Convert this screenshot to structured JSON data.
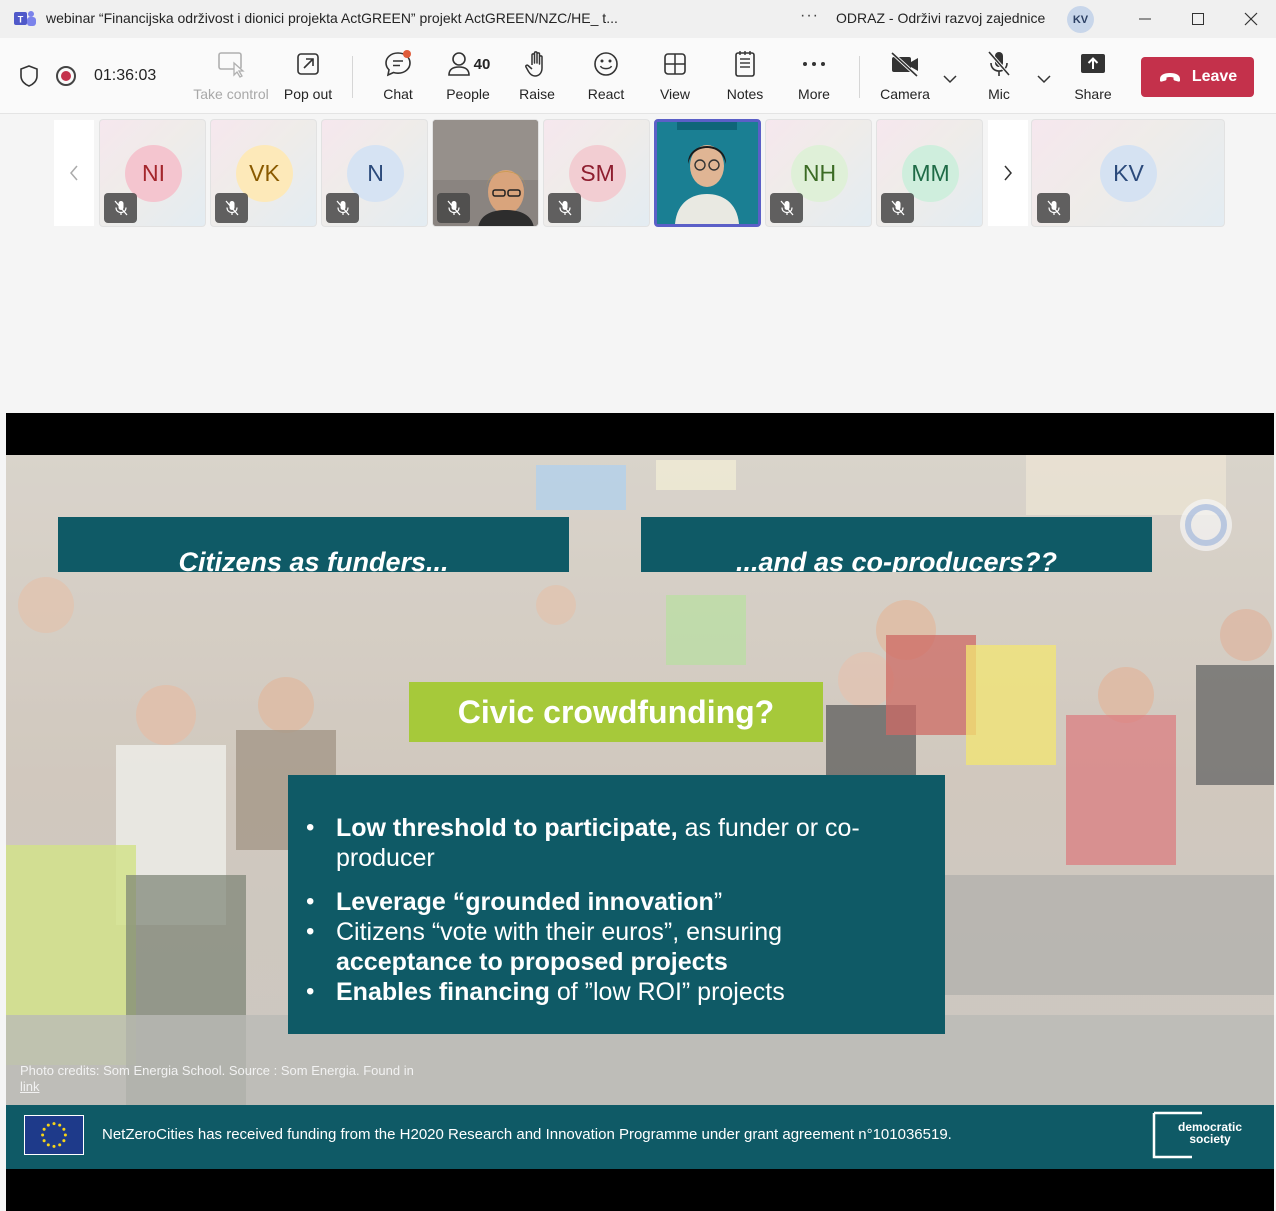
{
  "window": {
    "title": "webinar “Financijska održivost i dionici projekta ActGREEN” projekt ActGREEN/NZC/HE_ t...",
    "more_dots": "···",
    "org_name": "ODRAZ - Održivi razvoj zajednice",
    "org_initials": "KV"
  },
  "toolbar": {
    "timer": "01:36:03",
    "take_control": "Take control",
    "pop_out": "Pop out",
    "chat": "Chat",
    "people": "People",
    "people_count": "40",
    "raise": "Raise",
    "react": "React",
    "view": "View",
    "notes": "Notes",
    "more": "More",
    "camera": "Camera",
    "mic": "Mic",
    "share": "Share",
    "leave": "Leave"
  },
  "participants": [
    {
      "initials": "NI",
      "color": "#f4c5cf",
      "text_color": "#a4262c"
    },
    {
      "initials": "VK",
      "color": "#fde9b9",
      "text_color": "#8a5a00"
    },
    {
      "initials": "N",
      "color": "#d6e3f3",
      "text_color": "#2b4a7b"
    },
    {
      "initials": "",
      "video": true
    },
    {
      "initials": "SM",
      "color": "#f2cdd2",
      "text_color": "#8e1e2f"
    },
    {
      "initials": "",
      "video": true,
      "active": true
    },
    {
      "initials": "NH",
      "color": "#dff0d8",
      "text_color": "#3b6b24"
    },
    {
      "initials": "MM",
      "color": "#cfeedd",
      "text_color": "#1f6b47"
    },
    {
      "initials": "KV",
      "color": "#d5e2f2",
      "text_color": "#2b4a7b"
    }
  ],
  "slide": {
    "banner_left": "Citizens as funders...",
    "banner_right": "...and as co-producers??",
    "civic_title": "Civic crowdfunding?",
    "bullets": {
      "b1_bold": "Low threshold to participate,",
      "b1_rest": " as funder or co-producer",
      "b2_bold": "Leverage “grounded innovation",
      "b2_rest": "”",
      "b3_rest": "Citizens “vote with their euros”, ensuring ",
      "b3_bold": "acceptance to proposed projects",
      "b4_bold": "Enables financing",
      "b4_rest": " of ”low ROI” projects"
    },
    "credit": "Photo credits:  Som Energia School. Source : Som Energia. Found in",
    "credit_link": "link",
    "funding": "NetZeroCities has received funding from the H2020 Research and Innovation Programme under grant agreement n°101036519.",
    "demsoc_line1": "democratic",
    "demsoc_line2": "society"
  },
  "colors": {
    "leave_red": "#c4314b",
    "slide_teal": "#0f5a66",
    "slide_green": "#a6c93a",
    "active_outline": "#5b5fc7"
  }
}
